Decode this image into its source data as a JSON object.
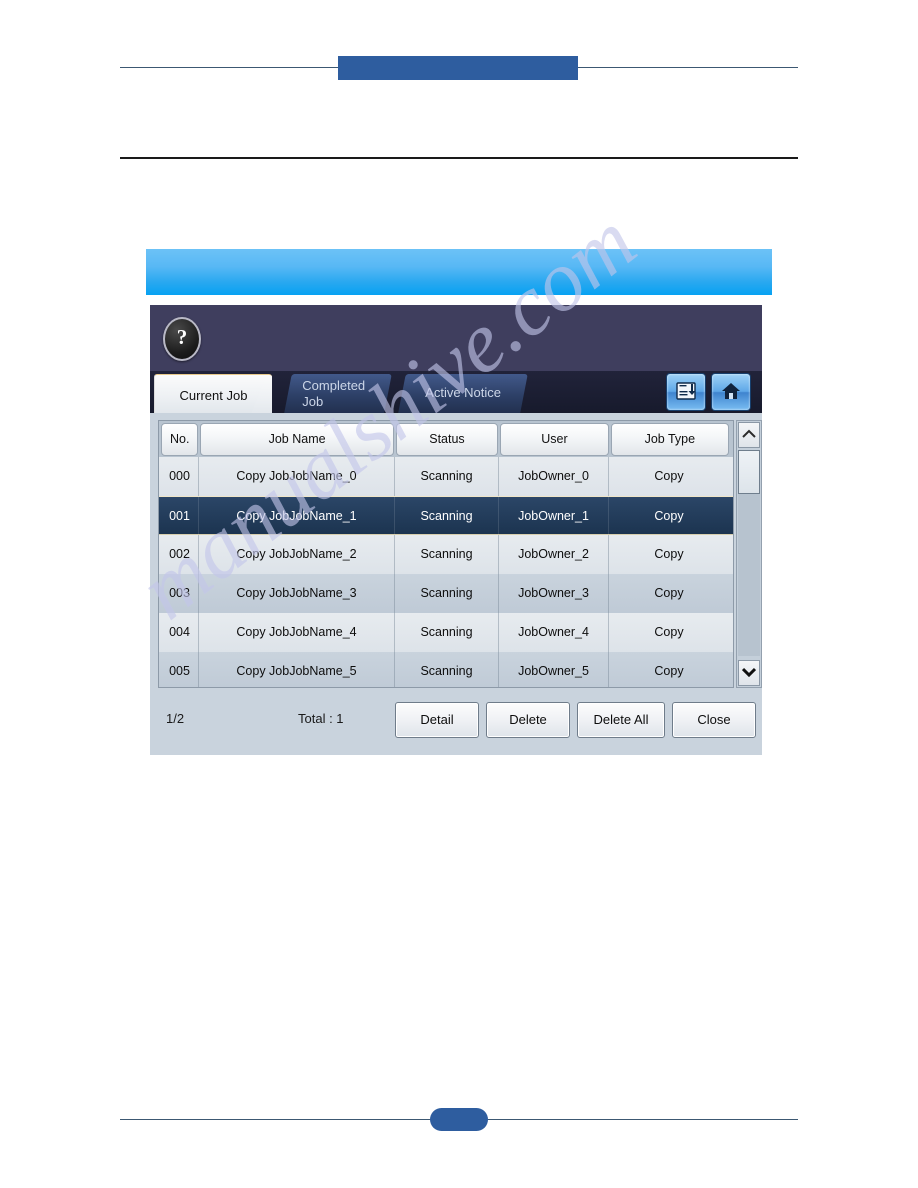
{
  "page": {
    "header_tab_color": "#2e5d9f",
    "rule_color": "#3c5872",
    "page_badge_color": "#2e5d9f"
  },
  "caption_banner": {
    "text": "",
    "color_top": "#6cc2f7",
    "color_bottom": "#07a2f2"
  },
  "watermark": {
    "text": "manualshive.com",
    "color": "#c3c6ea"
  },
  "panel": {
    "header": {
      "help_label": "?",
      "background": "#3f3e5e"
    },
    "tabs": [
      {
        "label": "Current Job",
        "active": true
      },
      {
        "label": "Completed Job",
        "active": false
      },
      {
        "label": "Active Notice",
        "active": false
      }
    ],
    "icon_buttons": [
      {
        "name": "save-to-document-icon",
        "label": ""
      },
      {
        "name": "home-icon",
        "label": ""
      }
    ],
    "table": {
      "columns": [
        {
          "key": "no",
          "label": "No."
        },
        {
          "key": "job_name",
          "label": "Job Name"
        },
        {
          "key": "status",
          "label": "Status"
        },
        {
          "key": "user",
          "label": "User"
        },
        {
          "key": "job_type",
          "label": "Job Type"
        }
      ],
      "rows": [
        {
          "no": "000",
          "job_name": "Copy JobJobName_0",
          "status": "Scanning",
          "user": "JobOwner_0",
          "job_type": "Copy",
          "selected": false
        },
        {
          "no": "001",
          "job_name": "Copy JobJobName_1",
          "status": "Scanning",
          "user": "JobOwner_1",
          "job_type": "Copy",
          "selected": true
        },
        {
          "no": "002",
          "job_name": "Copy JobJobName_2",
          "status": "Scanning",
          "user": "JobOwner_2",
          "job_type": "Copy",
          "selected": false
        },
        {
          "no": "003",
          "job_name": "Copy JobJobName_3",
          "status": "Scanning",
          "user": "JobOwner_3",
          "job_type": "Copy",
          "selected": false
        },
        {
          "no": "004",
          "job_name": "Copy JobJobName_4",
          "status": "Scanning",
          "user": "JobOwner_4",
          "job_type": "Copy",
          "selected": false
        },
        {
          "no": "005",
          "job_name": "Copy JobJobName_5",
          "status": "Scanning",
          "user": "JobOwner_5",
          "job_type": "Copy",
          "selected": false
        }
      ],
      "selected_row_color": "#1c3450"
    },
    "scrollbar": {
      "up_glyph": "⌃",
      "down_glyph": "⌄"
    },
    "footer": {
      "page_indicator": "1/2",
      "total_label": "Total : 1",
      "buttons": [
        {
          "label": "Detail"
        },
        {
          "label": "Delete"
        },
        {
          "label": "Delete All"
        },
        {
          "label": "Close"
        }
      ]
    }
  }
}
